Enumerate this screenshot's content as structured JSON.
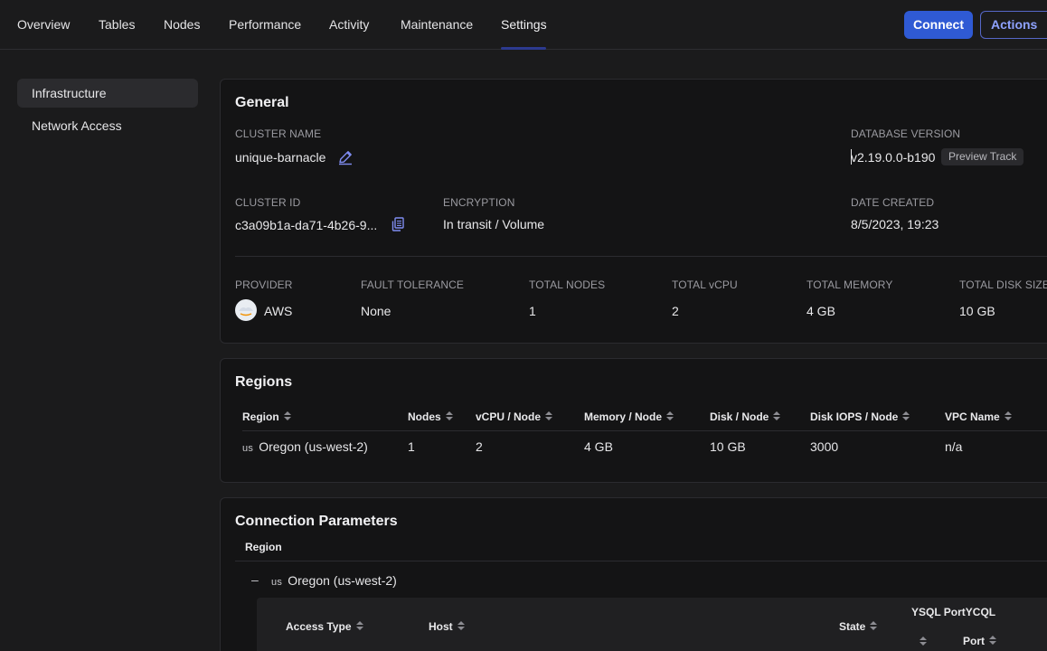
{
  "nav": {
    "tabs": [
      {
        "label": "Overview"
      },
      {
        "label": "Tables"
      },
      {
        "label": "Nodes"
      },
      {
        "label": "Performance"
      },
      {
        "label": "Activity"
      },
      {
        "label": "Maintenance"
      },
      {
        "label": "Settings",
        "active": true
      }
    ],
    "connect_label": "Connect",
    "actions_label": "Actions"
  },
  "sidebar": {
    "items": [
      {
        "label": "Infrastructure",
        "active": true
      },
      {
        "label": "Network Access"
      }
    ]
  },
  "general": {
    "title": "General",
    "cluster_name_label": "CLUSTER NAME",
    "cluster_name": "unique-barnacle",
    "database_version_label": "DATABASE VERSION",
    "database_version": "v2.19.0.0-b190",
    "track_badge": "Preview Track",
    "cluster_id_label": "CLUSTER ID",
    "cluster_id": "c3a09b1a-da71-4b26-9...",
    "encryption_label": "ENCRYPTION",
    "encryption": "In transit / Volume",
    "date_created_label": "DATE CREATED",
    "date_created": "8/5/2023, 19:23",
    "provider_label": "PROVIDER",
    "provider": "AWS",
    "fault_tolerance_label": "FAULT TOLERANCE",
    "fault_tolerance": "None",
    "total_nodes_label": "TOTAL NODES",
    "total_nodes": "1",
    "total_vcpu_label": "TOTAL vCPU",
    "total_vcpu": "2",
    "total_memory_label": "TOTAL MEMORY",
    "total_memory": "4 GB",
    "total_disk_label": "TOTAL DISK SIZE",
    "total_disk": "10 GB"
  },
  "regions": {
    "title": "Regions",
    "columns": [
      "Region",
      "Nodes",
      "vCPU / Node",
      "Memory / Node",
      "Disk / Node",
      "Disk IOPS / Node",
      "VPC Name"
    ],
    "rows": [
      {
        "flag": "us",
        "region": "Oregon (us-west-2)",
        "nodes": "1",
        "vcpu": "2",
        "memory": "4 GB",
        "disk": "10 GB",
        "iops": "3000",
        "vpc": "n/a"
      }
    ]
  },
  "connection": {
    "title": "Connection Parameters",
    "region_header": "Region",
    "expand_symbol": "–",
    "region_flag": "us",
    "region_name": "Oregon (us-west-2)",
    "columns": {
      "access_type": "Access Type",
      "host": "Host",
      "state": "State",
      "ysql_port": "YSQL Port",
      "ycql": "YCQL",
      "port": "Port"
    }
  }
}
